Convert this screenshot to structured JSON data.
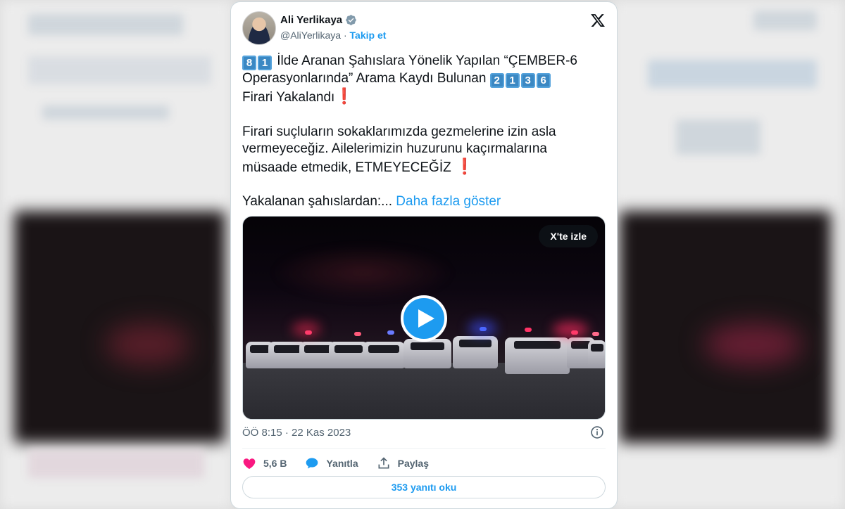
{
  "author": {
    "name": "Ali Yerlikaya",
    "handle": "@AliYerlikaya",
    "separator": " · ",
    "follow_label": "Takip et"
  },
  "tweet": {
    "badge_81": [
      "8",
      "1"
    ],
    "line1_text": " İlde Aranan Şahıslara Yönelik Yapılan “ÇEMBER-6 Operasyonlarında” Arama Kaydı Bulunan ",
    "badge_2136": [
      "2",
      "1",
      "3",
      "6"
    ],
    "line1_end": " Firari Yakalandı",
    "exclamation": "❗",
    "paragraph2": "Firari suçluların sokaklarımızda gezmelerine izin asla vermeyeceğiz. Ailelerimizin huzurunu kaçırmalarına müsaade etmedik, ETMEYECEĞİZ ",
    "paragraph3": "Yakalanan şahıslardan:... ",
    "show_more": "Daha fazla göster"
  },
  "video": {
    "watch_on_x": "X'te izle"
  },
  "meta": {
    "timestamp": "ÖÖ 8:15 · 22 Kas 2023"
  },
  "actions": {
    "likes": "5,6 B",
    "reply": "Yanıtla",
    "share": "Paylaş"
  },
  "read_replies": "353 yanıtı oku",
  "colors": {
    "accent": "#1d9bf0",
    "like": "#f91880",
    "keycap": "#3b88c3",
    "exclamation": "#d7263d"
  },
  "icons": [
    "verified-badge-icon",
    "x-logo-icon",
    "play-icon",
    "info-icon",
    "heart-icon",
    "reply-bubble-icon",
    "share-icon"
  ]
}
